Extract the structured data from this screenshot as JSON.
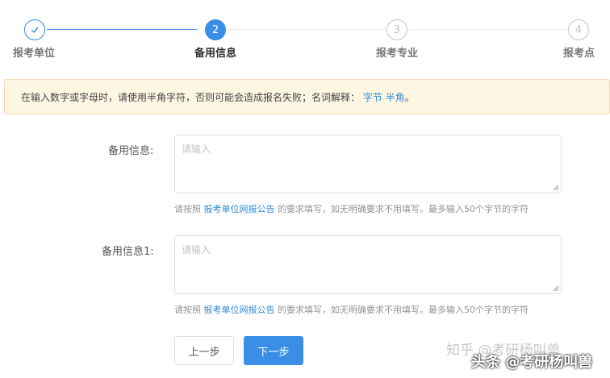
{
  "steps": [
    {
      "label": "报考单位",
      "number": "1",
      "status": "done"
    },
    {
      "label": "备用信息",
      "number": "2",
      "status": "active"
    },
    {
      "label": "报考专业",
      "number": "3",
      "status": "todo"
    },
    {
      "label": "报考点",
      "number": "4",
      "status": "todo"
    }
  ],
  "notice": {
    "text": "在输入数字或字母时，请使用半角字符，否则可能会造成报名失败；名词解释：",
    "link1": "字节",
    "link2": "半角",
    "end": "。"
  },
  "form": {
    "field1": {
      "label": "备用信息:",
      "placeholder": "请输入",
      "hint_prefix": "请按照",
      "hint_link": "报考单位网报公告",
      "hint_suffix": "的要求填写，如无明确要求不用填写。最多输入50个字节的字符"
    },
    "field2": {
      "label": "备用信息1:",
      "placeholder": "请输入",
      "hint_prefix": "请按照",
      "hint_link": "报考单位网报公告",
      "hint_suffix": "的要求填写，如无明确要求不用填写。最多输入50个字节的字符"
    }
  },
  "buttons": {
    "prev": "上一步",
    "next": "下一步"
  },
  "watermark": {
    "zhihu": "知乎 @考研杨叫兽",
    "toutiao": "头条 @考研杨叫兽"
  },
  "colors": {
    "primary": "#3a8ee6",
    "notice_bg": "#fdf6e3",
    "link": "#2f8ad8"
  }
}
